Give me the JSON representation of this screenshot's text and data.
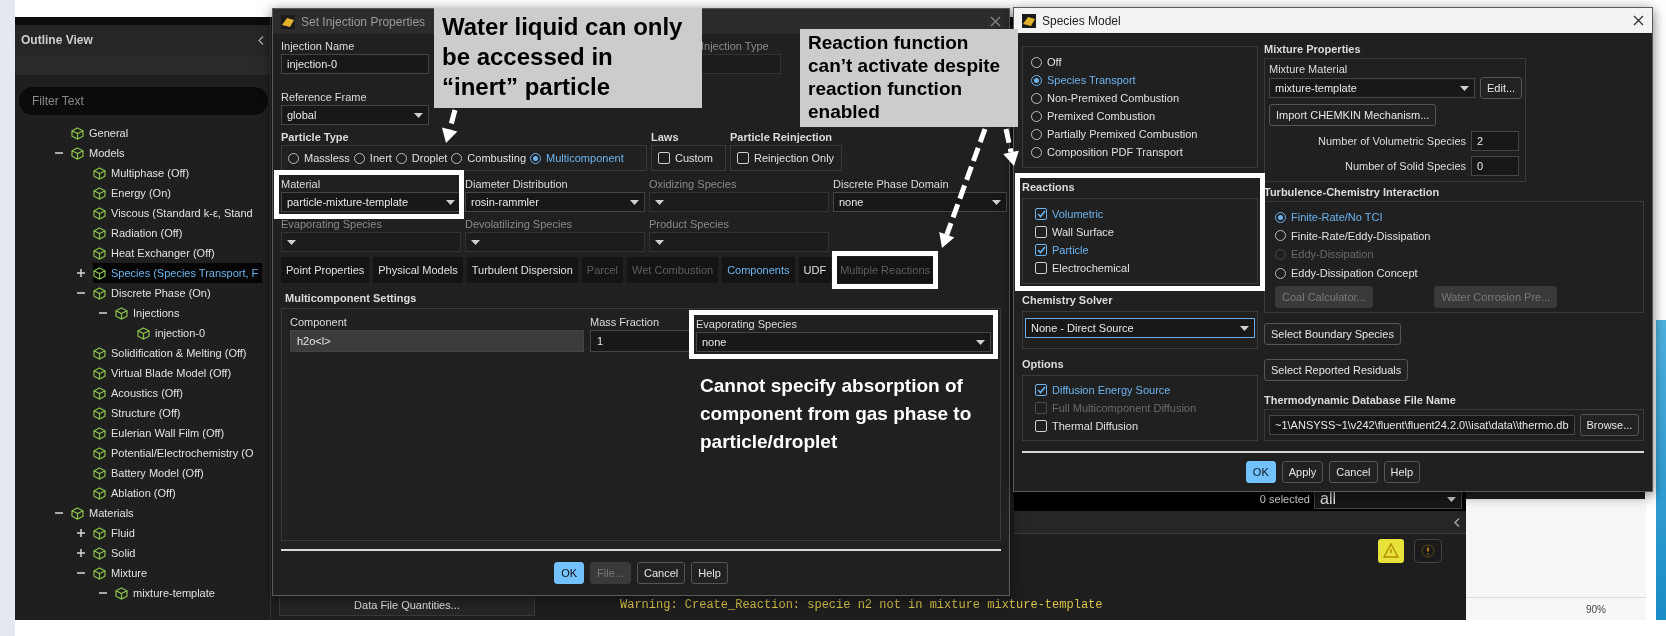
{
  "outline_view": {
    "title": "Outline View",
    "filter": {
      "placeholder": "Filter Text"
    },
    "tree": [
      {
        "label": "General",
        "selected": false
      },
      {
        "label": "Models",
        "expanded": true,
        "selected": false,
        "children": [
          {
            "label": "Multiphase (Off)",
            "selected": false
          },
          {
            "label": "Energy (On)",
            "selected": false
          },
          {
            "label": "Viscous (Standard k-ε, Stand",
            "selected": false
          },
          {
            "label": "Radiation (Off)",
            "selected": false
          },
          {
            "label": "Heat Exchanger (Off)",
            "selected": false
          },
          {
            "label": "Species (Species Transport, F",
            "expanded": false,
            "selected": true
          },
          {
            "label": "Discrete Phase (On)",
            "expanded": true,
            "selected": false,
            "children": [
              {
                "label": "Injections",
                "expanded": true,
                "selected": false,
                "children": [
                  {
                    "label": "injection-0",
                    "selected": false
                  }
                ]
              }
            ]
          },
          {
            "label": "Solidification & Melting (Off)",
            "selected": false
          },
          {
            "label": "Virtual Blade Model (Off)",
            "selected": false
          },
          {
            "label": "Acoustics (Off)",
            "selected": false
          },
          {
            "label": "Structure (Off)",
            "selected": false
          },
          {
            "label": "Eulerian Wall Film (Off)",
            "selected": false
          },
          {
            "label": "Potential/Electrochemistry (O",
            "selected": false
          },
          {
            "label": "Battery Model (Off)",
            "selected": false
          },
          {
            "label": "Ablation (Off)",
            "selected": false
          }
        ]
      },
      {
        "label": "Materials",
        "expanded": true,
        "selected": false,
        "children": [
          {
            "label": "Fluid",
            "expanded": false,
            "selected": false
          },
          {
            "label": "Solid",
            "expanded": false,
            "selected": false
          },
          {
            "label": "Mixture",
            "expanded": true,
            "selected": false,
            "children": [
              {
                "label": "mixture-template",
                "expanded": true,
                "selected": false
              }
            ]
          }
        ]
      }
    ]
  },
  "injection_dialog": {
    "title": "Set Injection Properties",
    "injection_name": {
      "label": "Injection Name",
      "value": "injection-0"
    },
    "injection_type": {
      "label": "Injection Type",
      "disabled": true
    },
    "reference_frame": {
      "label": "Reference Frame",
      "value": "global"
    },
    "particle_type": {
      "label": "Particle Type",
      "options": [
        {
          "label": "Massless",
          "selected": false
        },
        {
          "label": "Inert",
          "selected": false
        },
        {
          "label": "Droplet",
          "selected": false
        },
        {
          "label": "Combusting",
          "selected": false
        },
        {
          "label": "Multicomponent",
          "selected": true
        }
      ]
    },
    "laws": {
      "label": "Laws",
      "options": [
        {
          "label": "Custom",
          "checked": false
        }
      ]
    },
    "particle_reinjection": {
      "label": "Particle Reinjection",
      "options": [
        {
          "label": "Reinjection Only",
          "checked": false
        }
      ]
    },
    "dropdowns": [
      {
        "label": "Material",
        "value": "particle-mixture-template",
        "disabled": false
      },
      {
        "label": "Diameter Distribution",
        "value": "rosin-rammler",
        "disabled": false
      },
      {
        "label": "Oxidizing Species",
        "disabled": true
      },
      {
        "label": "Discrete Phase Domain",
        "value": "none",
        "disabled": false
      },
      {
        "label": "Evaporating Species",
        "disabled": true
      },
      {
        "label": "Devolatilizing Species",
        "disabled": true
      },
      {
        "label": "Product Species",
        "disabled": true
      }
    ],
    "tabs": [
      {
        "label": "Point Properties",
        "selected": false,
        "disabled": false
      },
      {
        "label": "Physical Models",
        "selected": false,
        "disabled": false
      },
      {
        "label": "Turbulent Dispersion",
        "selected": false,
        "disabled": false
      },
      {
        "label": "Parcel",
        "selected": false,
        "disabled": true
      },
      {
        "label": "Wet Combustion",
        "selected": false,
        "disabled": true
      },
      {
        "label": "Components",
        "selected": true,
        "disabled": false
      },
      {
        "label": "UDF",
        "selected": false,
        "disabled": false
      },
      {
        "label": "Multiple Reactions",
        "selected": false,
        "disabled": true
      }
    ],
    "multicomponent": {
      "title": "Multicomponent Settings",
      "columns": [
        "Component",
        "Mass Fraction"
      ],
      "rows": [
        [
          "h2o<l>",
          "1"
        ]
      ],
      "evaporating_species": {
        "label": "Evaporating Species",
        "value": "none"
      }
    },
    "buttons": [
      {
        "label": "OK",
        "kind": "primary"
      },
      {
        "label": "File...",
        "kind": "disabled"
      },
      {
        "label": "Cancel",
        "kind": "normal"
      },
      {
        "label": "Help",
        "kind": "normal"
      }
    ]
  },
  "species_model": {
    "title": "Species Model",
    "model_options": [
      {
        "label": "Off",
        "selected": false
      },
      {
        "label": "Species Transport",
        "selected": true
      },
      {
        "label": "Non-Premixed Combustion",
        "selected": false
      },
      {
        "label": "Premixed Combustion",
        "selected": false
      },
      {
        "label": "Partially Premixed Combustion",
        "selected": false
      },
      {
        "label": "Composition PDF Transport",
        "selected": false
      }
    ],
    "reactions": {
      "label": "Reactions",
      "options": [
        {
          "label": "Volumetric",
          "checked": true,
          "disabled": false
        },
        {
          "label": "Wall Surface",
          "checked": false,
          "disabled": false
        },
        {
          "label": "Particle",
          "checked": true,
          "disabled": false
        },
        {
          "label": "Electrochemical",
          "checked": false,
          "disabled": false
        }
      ]
    },
    "chemistry_solver": {
      "label": "Chemistry Solver",
      "value": "None - Direct Source"
    },
    "options": {
      "label": "Options",
      "items": [
        {
          "label": "Diffusion Energy Source",
          "checked": true,
          "disabled": false
        },
        {
          "label": "Full Multicomponent Diffusion",
          "checked": false,
          "disabled": true
        },
        {
          "label": "Thermal Diffusion",
          "checked": false,
          "disabled": false
        }
      ]
    },
    "mixture_properties": {
      "label": "Mixture Properties",
      "material_label": "Mixture Material",
      "material": "mixture-template",
      "edit_button": "Edit...",
      "import_button": "Import CHEMKIN Mechanism...",
      "fields": [
        {
          "label": "Number of Volumetric Species",
          "value": "2"
        },
        {
          "label": "Number of Solid Species",
          "value": "0"
        }
      ]
    },
    "turbulence_chemistry": {
      "label": "Turbulence-Chemistry Interaction",
      "options": [
        {
          "label": "Finite-Rate/No TCI",
          "selected": true,
          "disabled": false
        },
        {
          "label": "Finite-Rate/Eddy-Dissipation",
          "selected": false,
          "disabled": false
        },
        {
          "label": "Eddy-Dissipation",
          "selected": false,
          "disabled": true
        },
        {
          "label": "Eddy-Dissipation Concept",
          "selected": false,
          "disabled": false
        }
      ],
      "buttons": [
        {
          "label": "Coal Calculator...",
          "disabled": true
        },
        {
          "label": "Water Corrosion Pre...",
          "disabled": true
        }
      ]
    },
    "side_buttons": [
      "Select Boundary Species",
      "Select Reported Residuals"
    ],
    "thermo_db": {
      "label": "Thermodynamic Database File Name",
      "value": "~1\\ANSYSS~1\\v242\\fluent\\fluent24.2.0\\\\isat\\data\\\\thermo.db",
      "button": "Browse..."
    },
    "buttons": [
      {
        "label": "OK",
        "kind": "primary"
      },
      {
        "label": "Apply",
        "kind": "normal"
      },
      {
        "label": "Cancel",
        "kind": "normal"
      },
      {
        "label": "Help",
        "kind": "normal"
      }
    ]
  },
  "workspace": {
    "data_button": "Data File Quantities...",
    "console_line": "Warning: Create_Reaction: specie n2 not in mixture mixture-template",
    "selection_count": "0 selected",
    "selection_filter": "all",
    "zoom_level": "90%"
  },
  "annotations": [
    {
      "kind": "callout",
      "text": "Water liquid can only be accessed in “inert” particle"
    },
    {
      "kind": "callout",
      "text": "Reaction function can’t activate despite reaction function enabled"
    },
    {
      "kind": "note",
      "text": "Cannot specify absorption of component from gas phase to particle/droplet"
    }
  ]
}
